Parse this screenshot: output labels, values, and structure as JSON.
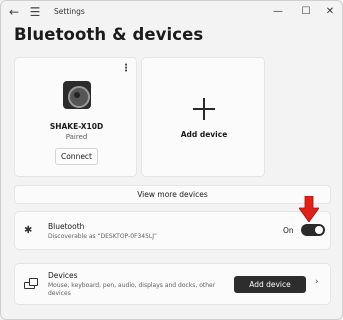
{
  "window": {
    "title": "Settings",
    "back_icon": "←",
    "menu_icon": "☰",
    "minimize_icon": "—",
    "maximize_icon": "☐",
    "close_icon": "✕"
  },
  "page": {
    "title": "Bluetooth & devices"
  },
  "device_card": {
    "menu_icon": "⋮",
    "name": "SHAKE-X10D",
    "status": "Paired",
    "connect_label": "Connect"
  },
  "add_card": {
    "label": "Add device"
  },
  "view_more": {
    "label": "View more devices"
  },
  "bluetooth": {
    "icon": "✱",
    "title": "Bluetooth",
    "subtitle": "Discoverable as “DESKTOP-0F345LJ”",
    "state_label": "On",
    "enabled": true
  },
  "devices": {
    "title": "Devices",
    "subtitle": "Mouse, keyboard, pen, audio, displays and docks, other devices",
    "add_label": "Add device",
    "chevron_icon": "›"
  },
  "colors": {
    "accent": "#2a2a2a",
    "arrow": "#e0201a"
  }
}
